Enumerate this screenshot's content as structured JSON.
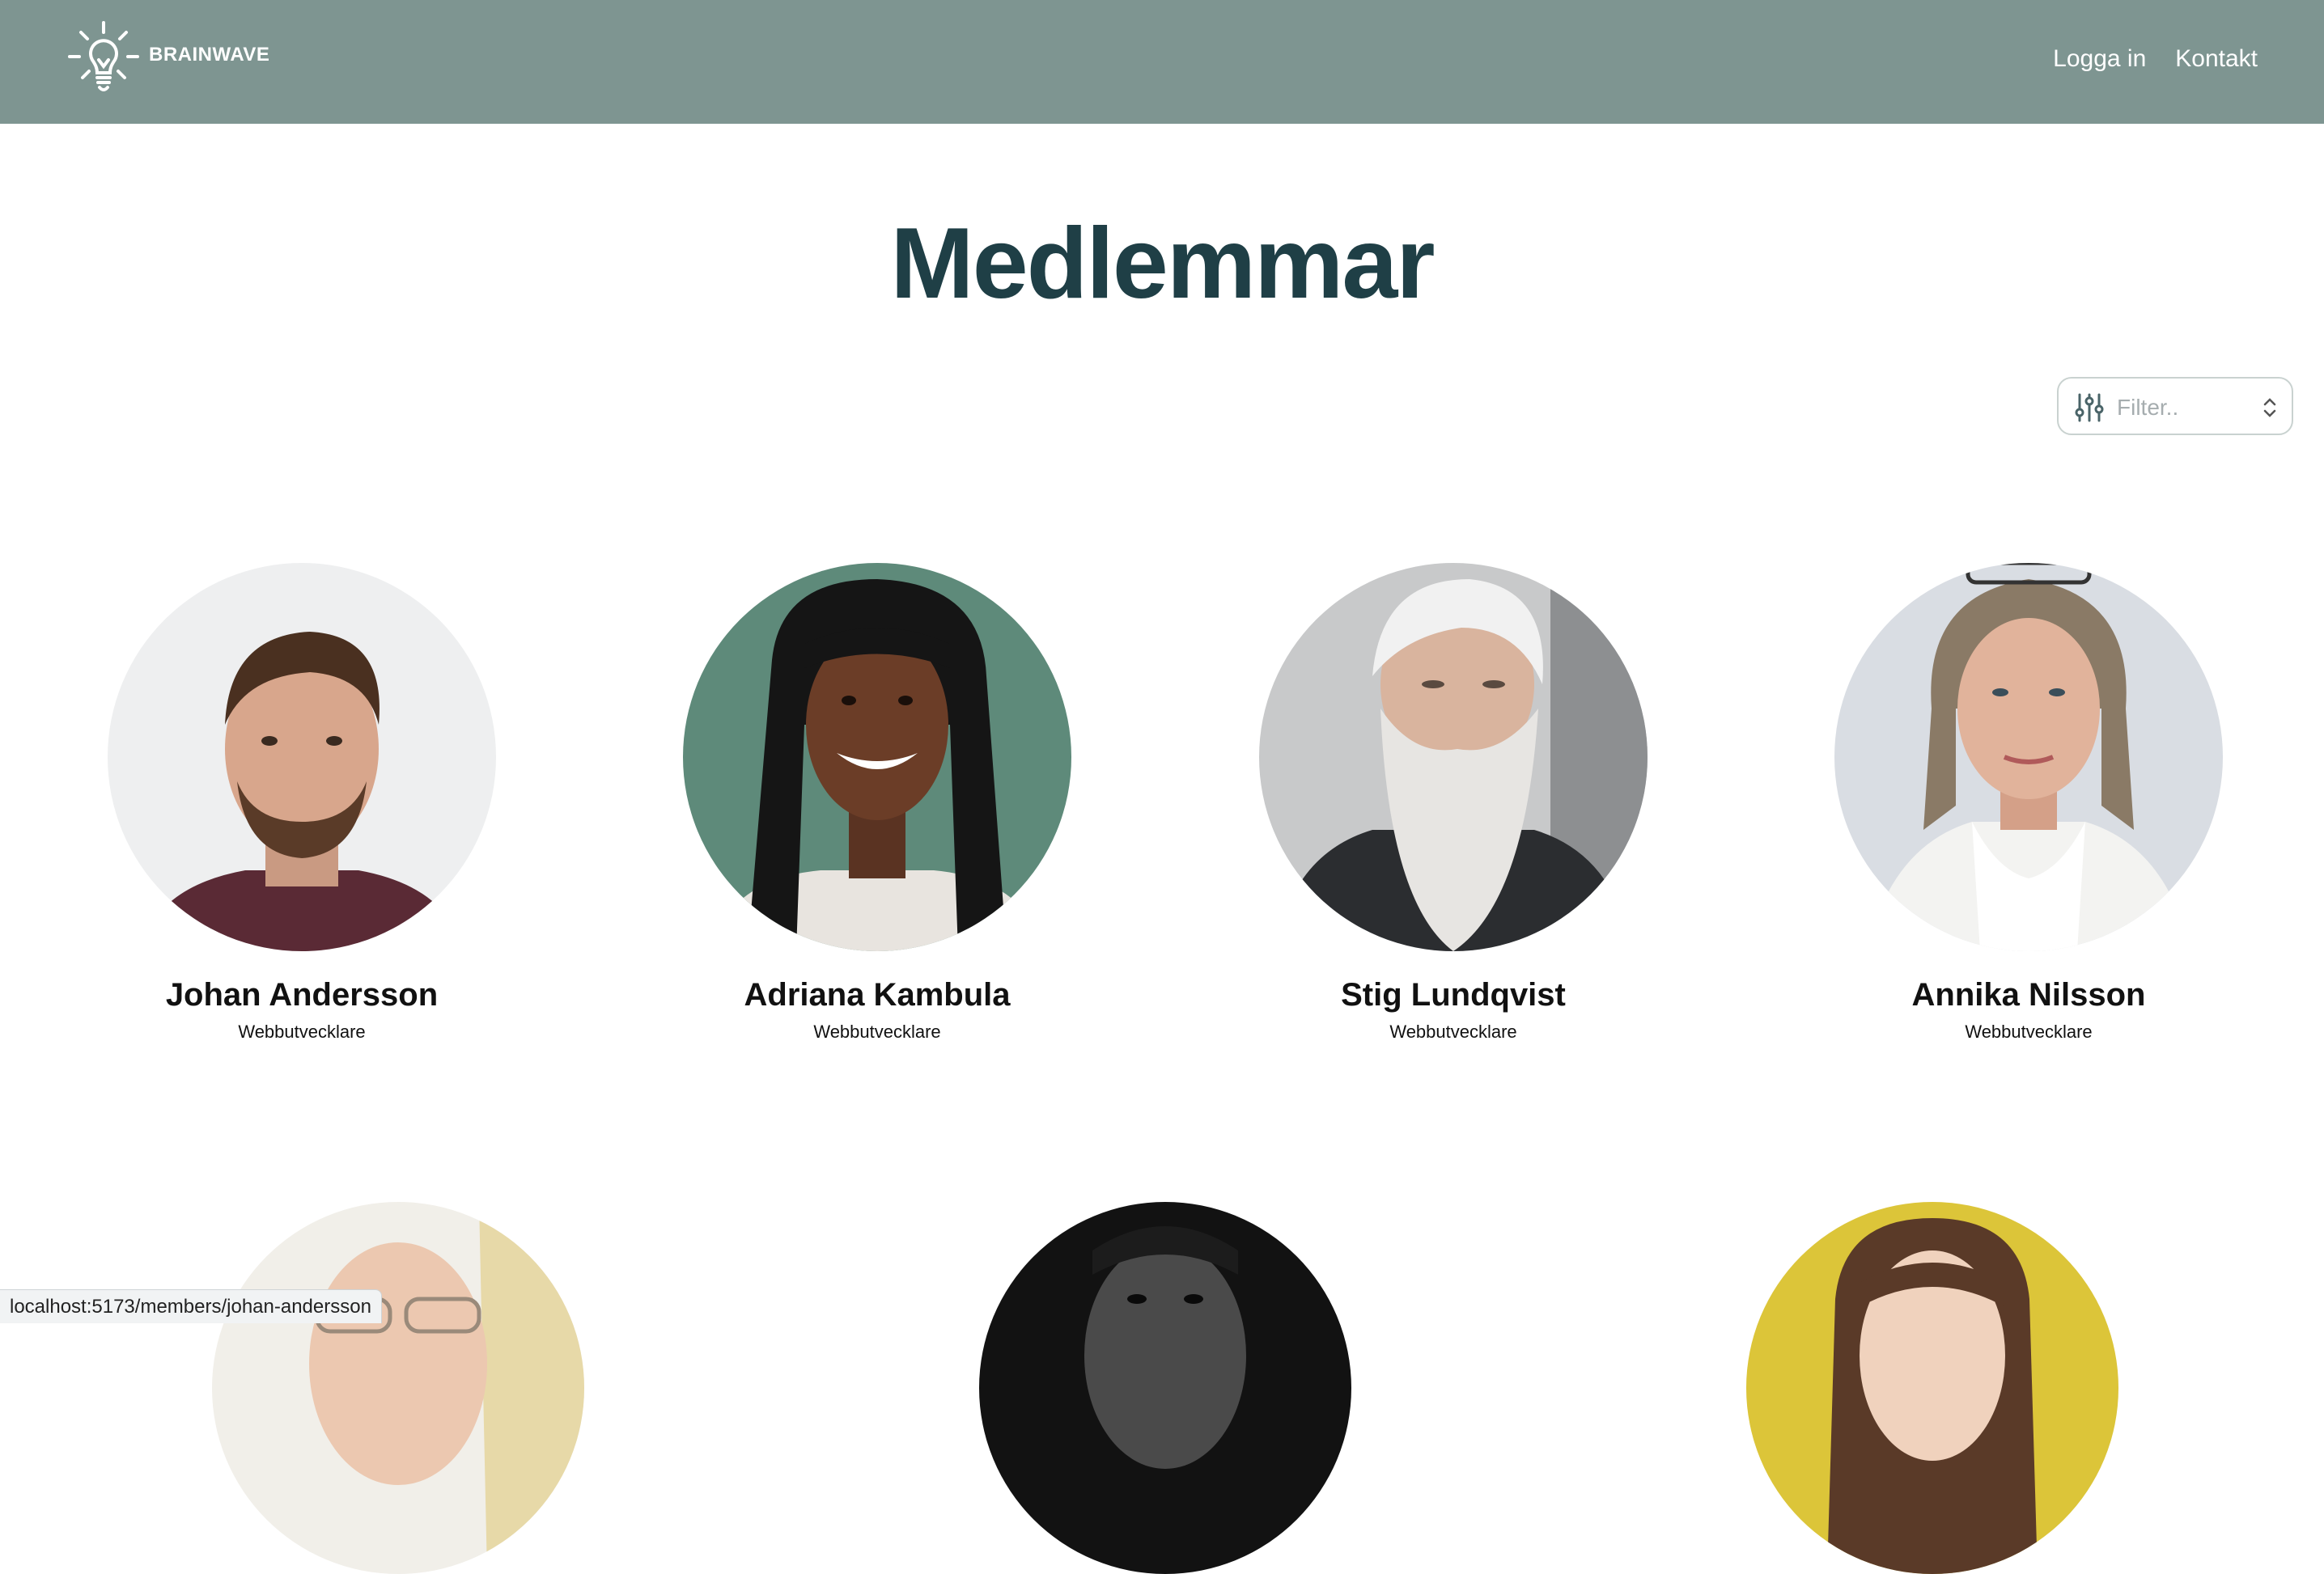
{
  "header": {
    "brand": "BRAINWAVE",
    "nav": [
      {
        "label": "Logga in"
      },
      {
        "label": "Kontakt"
      }
    ],
    "bg_color": "#7e9591"
  },
  "page": {
    "title": "Medlemmar"
  },
  "filter": {
    "placeholder": "Filter.."
  },
  "members": [
    {
      "name": "Johan Andersson",
      "role": "Webbutvecklare"
    },
    {
      "name": "Adriana Kambula",
      "role": "Webbutvecklare"
    },
    {
      "name": "Stig Lundqvist",
      "role": "Webbutvecklare"
    },
    {
      "name": "Annika Nilsson",
      "role": "Webbutvecklare"
    }
  ],
  "status_bar": {
    "url": "localhost:5173/members/johan-andersson"
  },
  "colors": {
    "title": "#1f3f46",
    "accent": "#7e9591"
  }
}
